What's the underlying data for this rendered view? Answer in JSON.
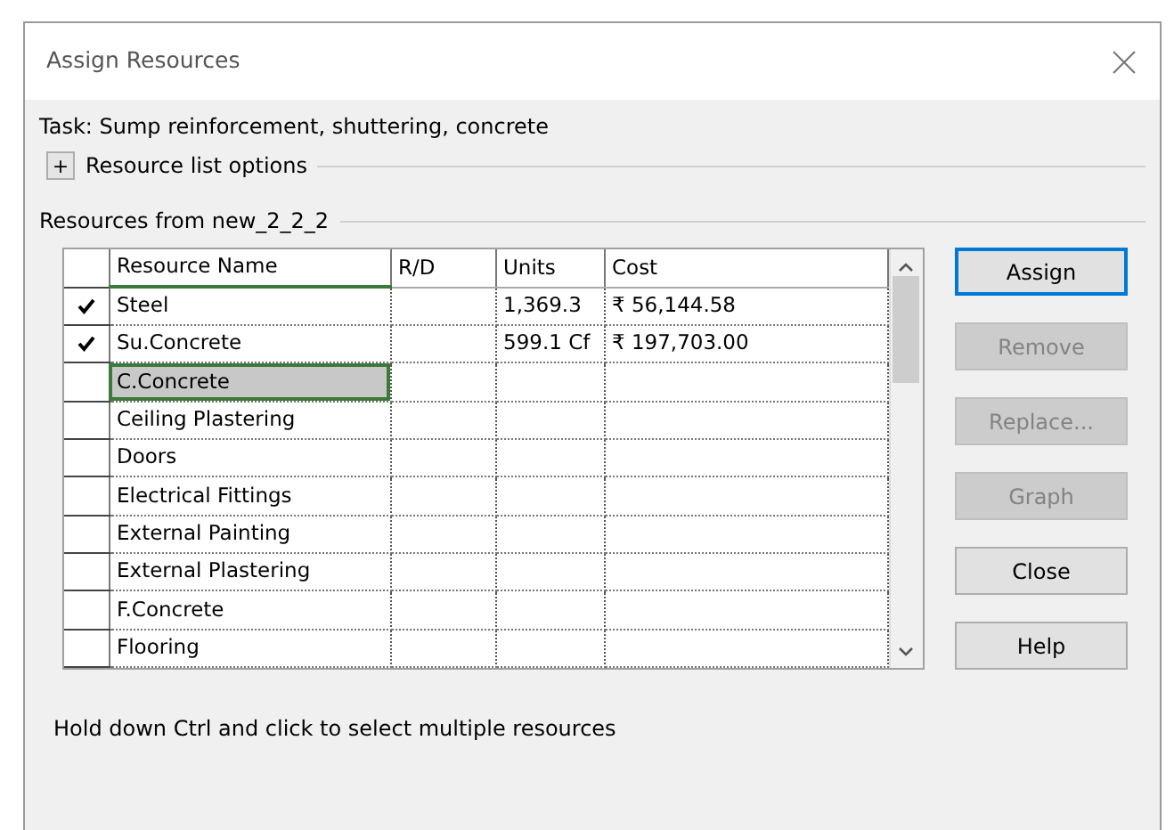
{
  "window": {
    "title": "Assign Resources"
  },
  "task": "Task: Sump reinforcement, shuttering, concrete",
  "options": {
    "label": "Resource list options",
    "expanded": false,
    "toggle": "+"
  },
  "group_label": "Resources from new_2_2_2",
  "table": {
    "columns": [
      "Resource Name",
      "R/D",
      "Units",
      "Cost"
    ],
    "rows": [
      {
        "assigned": true,
        "selected": false,
        "cells": [
          "Steel",
          "",
          "1,369.3",
          "₹ 56,144.58"
        ]
      },
      {
        "assigned": true,
        "selected": false,
        "cells": [
          "Su.Concrete",
          "",
          "599.1 Cf",
          "₹ 197,703.00"
        ]
      },
      {
        "assigned": false,
        "selected": true,
        "cells": [
          "C.Concrete",
          "",
          "",
          ""
        ]
      },
      {
        "assigned": false,
        "selected": false,
        "cells": [
          "Ceiling Plastering",
          "",
          "",
          ""
        ]
      },
      {
        "assigned": false,
        "selected": false,
        "cells": [
          "Doors",
          "",
          "",
          ""
        ]
      },
      {
        "assigned": false,
        "selected": false,
        "cells": [
          "Electrical Fittings",
          "",
          "",
          ""
        ]
      },
      {
        "assigned": false,
        "selected": false,
        "cells": [
          "External Painting",
          "",
          "",
          ""
        ]
      },
      {
        "assigned": false,
        "selected": false,
        "cells": [
          "External Plastering",
          "",
          "",
          ""
        ]
      },
      {
        "assigned": false,
        "selected": false,
        "cells": [
          "F.Concrete",
          "",
          "",
          ""
        ]
      },
      {
        "assigned": false,
        "selected": false,
        "cells": [
          "Flooring",
          "",
          "",
          ""
        ]
      }
    ]
  },
  "buttons": [
    {
      "label": "Assign",
      "disabled": false,
      "default": true
    },
    {
      "label": "Remove",
      "disabled": true,
      "default": false
    },
    {
      "label": "Replace...",
      "disabled": true,
      "default": false
    },
    {
      "label": "Graph",
      "disabled": true,
      "default": false
    },
    {
      "label": "Close",
      "disabled": false,
      "default": false
    },
    {
      "label": "Help",
      "disabled": false,
      "default": false
    }
  ],
  "hint": "Hold down Ctrl and click to select multiple resources"
}
